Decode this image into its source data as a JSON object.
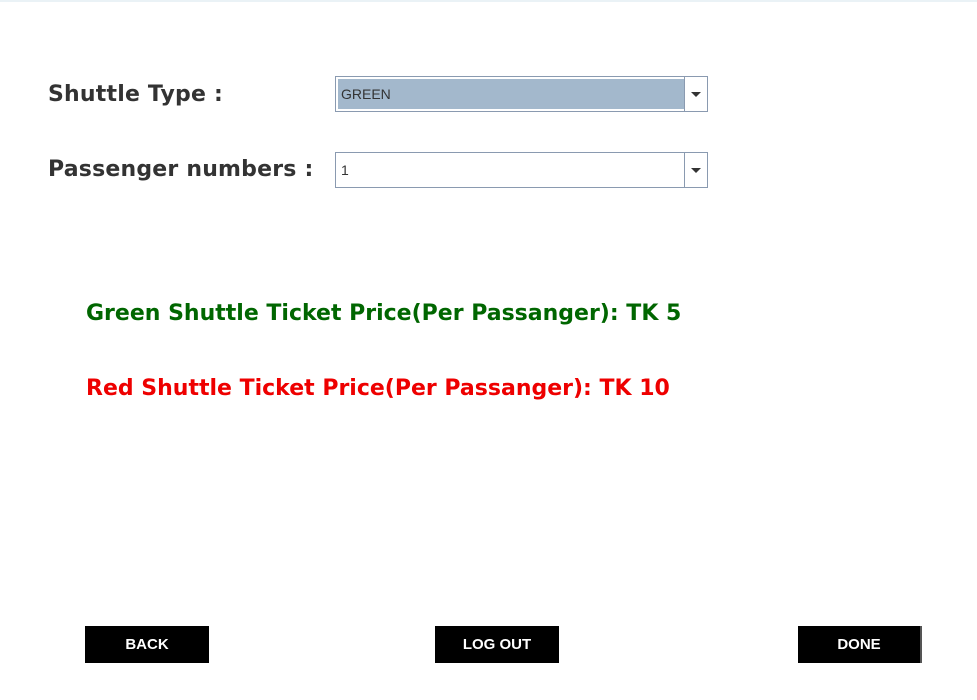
{
  "form": {
    "shuttle_type": {
      "label": "Shuttle Type :",
      "value": "GREEN"
    },
    "passenger_numbers": {
      "label": "Passenger numbers :",
      "value": "1"
    }
  },
  "prices": {
    "green": {
      "text": "Green Shuttle Ticket Price(Per Passanger): TK 5",
      "color": "#006600"
    },
    "red": {
      "text": "Red Shuttle Ticket Price(Per Passanger): TK 10",
      "color": "#ee0000"
    }
  },
  "buttons": {
    "back": "BACK",
    "logout": "LOG OUT",
    "done": "DONE"
  }
}
